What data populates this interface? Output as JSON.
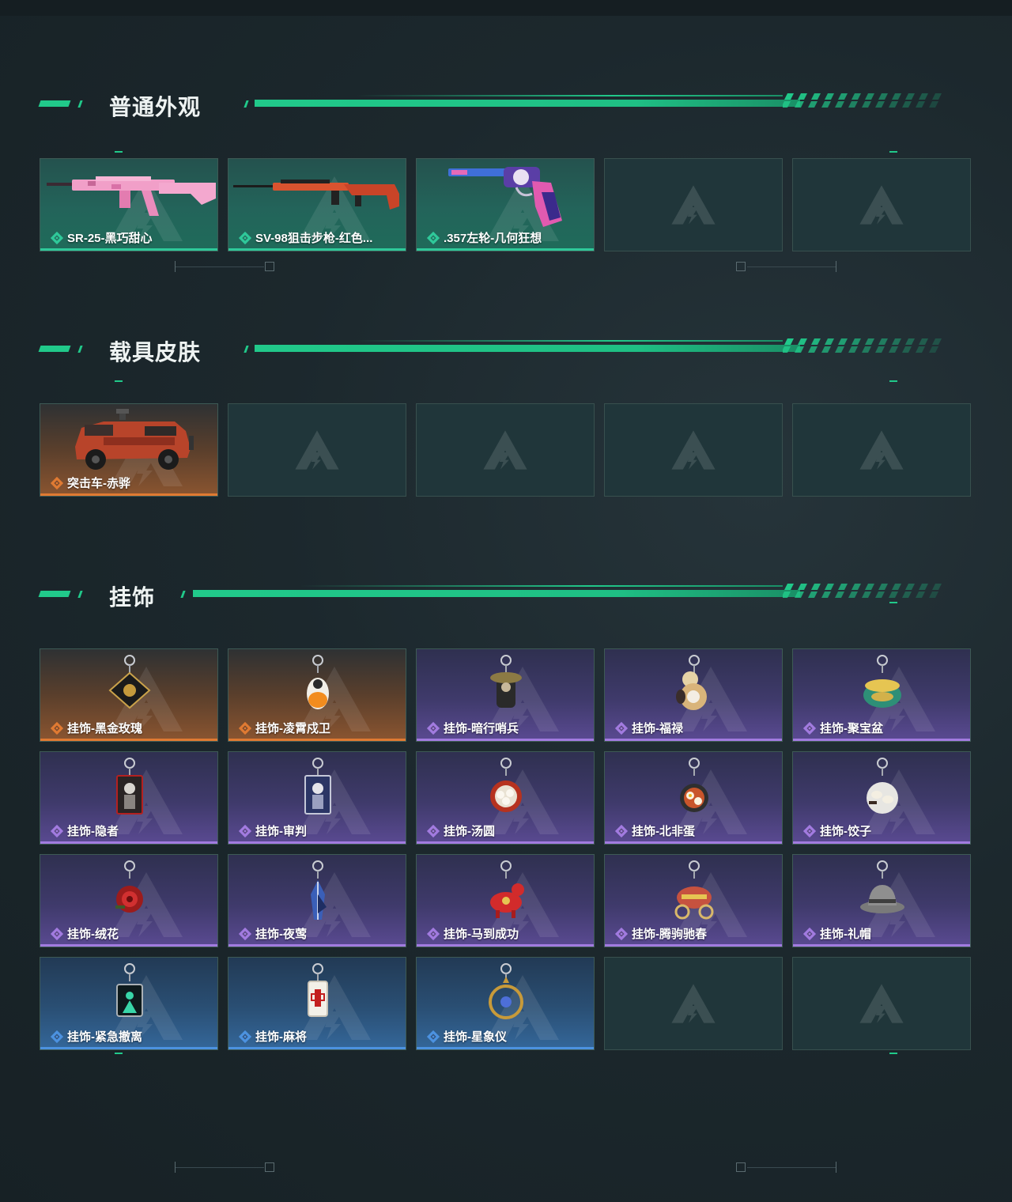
{
  "colors": {
    "accent": "#21c98a",
    "rarity_green": "#2fc99a",
    "rarity_orange": "#e07a32",
    "rarity_purple": "#a27be0",
    "rarity_blue": "#4c92e0"
  },
  "sections": [
    {
      "title": "普通外观",
      "items": [
        {
          "label": "SR-25-黑巧甜心",
          "rarity": "green",
          "icon": "pink-rifle-icon"
        },
        {
          "label": "SV-98狙击步枪-红色...",
          "rarity": "green",
          "icon": "red-sniper-rifle-icon"
        },
        {
          "label": ".357左轮-几何狂想",
          "rarity": "green",
          "icon": "revolver-icon"
        },
        {
          "label": "",
          "rarity": "empty"
        },
        {
          "label": "",
          "rarity": "empty"
        }
      ]
    },
    {
      "title": "载具皮肤",
      "items": [
        {
          "label": "突击车-赤骅",
          "rarity": "orange",
          "icon": "assault-vehicle-icon"
        },
        {
          "label": "",
          "rarity": "empty"
        },
        {
          "label": "",
          "rarity": "empty"
        },
        {
          "label": "",
          "rarity": "empty"
        },
        {
          "label": "",
          "rarity": "empty"
        }
      ]
    },
    {
      "title": "挂饰",
      "items": [
        {
          "label": "挂饰-黑金玫瑰",
          "rarity": "orange",
          "icon": "black-gold-rose-charm-icon"
        },
        {
          "label": "挂饰-凌霄戍卫",
          "rarity": "orange",
          "icon": "guardian-charm-icon"
        },
        {
          "label": "挂饰-暗行哨兵",
          "rarity": "purple",
          "icon": "sentinel-charm-icon"
        },
        {
          "label": "挂饰-福禄",
          "rarity": "purple",
          "icon": "gourd-charm-icon"
        },
        {
          "label": "挂饰-聚宝盆",
          "rarity": "purple",
          "icon": "treasure-bowl-charm-icon"
        },
        {
          "label": "挂饰-隐者",
          "rarity": "purple",
          "icon": "hermit-card-charm-icon"
        },
        {
          "label": "挂饰-审判",
          "rarity": "purple",
          "icon": "judgement-card-charm-icon"
        },
        {
          "label": "挂饰-汤圆",
          "rarity": "purple",
          "icon": "tangyuan-charm-icon"
        },
        {
          "label": "挂饰-北非蛋",
          "rarity": "purple",
          "icon": "shakshuka-charm-icon"
        },
        {
          "label": "挂饰-饺子",
          "rarity": "purple",
          "icon": "dumpling-charm-icon"
        },
        {
          "label": "挂饰-绒花",
          "rarity": "purple",
          "icon": "velvet-flower-charm-icon"
        },
        {
          "label": "挂饰-夜莺",
          "rarity": "purple",
          "icon": "nightingale-feather-charm-icon"
        },
        {
          "label": "挂饰-马到成功",
          "rarity": "purple",
          "icon": "horse-charm-icon"
        },
        {
          "label": "挂饰-腾驹驰春",
          "rarity": "purple",
          "icon": "carriage-charm-icon"
        },
        {
          "label": "挂饰-礼帽",
          "rarity": "purple",
          "icon": "hat-charm-icon"
        },
        {
          "label": "挂饰-紧急撤离",
          "rarity": "blue",
          "icon": "evac-sign-charm-icon"
        },
        {
          "label": "挂饰-麻将",
          "rarity": "blue",
          "icon": "mahjong-charm-icon"
        },
        {
          "label": "挂饰-星象仪",
          "rarity": "blue",
          "icon": "astrolabe-charm-icon"
        },
        {
          "label": "",
          "rarity": "empty"
        },
        {
          "label": "",
          "rarity": "empty"
        }
      ]
    }
  ]
}
